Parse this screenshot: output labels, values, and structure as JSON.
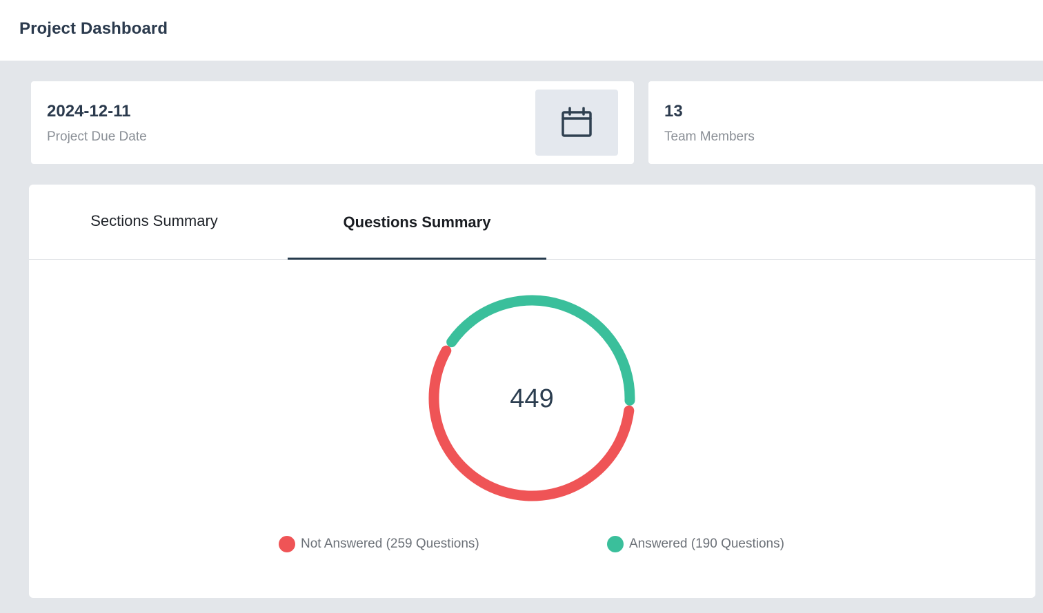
{
  "header": {
    "title": "Project Dashboard"
  },
  "cards": {
    "due_date": {
      "value": "2024-12-11",
      "label": "Project Due Date",
      "icon": "calendar-icon"
    },
    "team": {
      "value": "13",
      "label": "Team Members"
    }
  },
  "tabs": [
    {
      "label": "Sections Summary",
      "active": false
    },
    {
      "label": "Questions Summary",
      "active": true
    }
  ],
  "chart_data": {
    "type": "pie",
    "variant": "donut",
    "center_label": "449",
    "slices": [
      {
        "name": "Not Answered (259 Questions)",
        "value": 259,
        "color": "#ef5456"
      },
      {
        "name": "Answered (190 Questions)",
        "value": 190,
        "color": "#3abf9b"
      }
    ],
    "legend_placement": "bottom"
  },
  "colors": {
    "accent": "#263b4d",
    "not_answered": "#ef5456",
    "answered": "#3abf9b"
  }
}
